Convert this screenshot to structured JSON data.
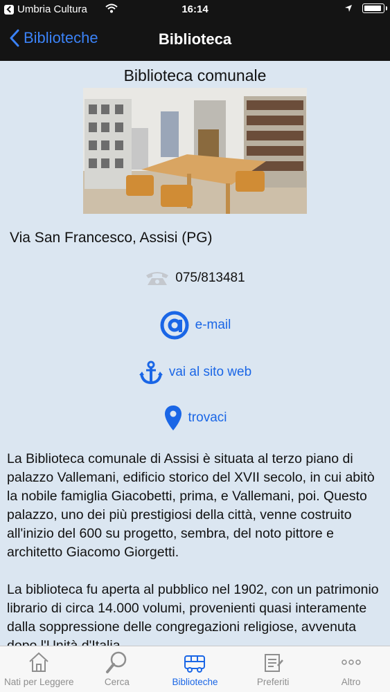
{
  "status_bar": {
    "back_app": "Umbria Cultura",
    "time": "16:14"
  },
  "nav": {
    "back_label": "Biblioteche",
    "title": "Biblioteca"
  },
  "library": {
    "name": "Biblioteca comunale",
    "address": "Via San Francesco, Assisi (PG)",
    "phone": "075/813481",
    "email_label": "e-mail",
    "website_label": "vai al sito web",
    "map_label": "trovaci",
    "description": [
      "La Biblioteca comunale di Assisi è situata al terzo piano di palazzo Vallemani, edificio storico del XVII secolo, in cui abitò la nobile famiglia Giacobetti, prima, e Vallemani, poi. Questo palazzo, uno dei più prestigiosi della città, venne costruito all'inizio del 600 su progetto, sembra, del noto pittore e architetto Giacomo Giorgetti.",
      "La biblioteca fu aperta al pubblico nel 1902, con un patrimonio librario di circa 14.000 volumi, provenienti quasi interamente dalla soppressione delle congregazioni religiose, avvenuta dopo l'Unità d'Italia."
    ]
  },
  "tabs": [
    {
      "label": "Nati per Leggere",
      "icon": "house-icon"
    },
    {
      "label": "Cerca",
      "icon": "search-icon"
    },
    {
      "label": "Biblioteche",
      "icon": "bus-icon",
      "active": true
    },
    {
      "label": "Preferiti",
      "icon": "notepad-icon"
    },
    {
      "label": "Altro",
      "icon": "more-icon"
    }
  ],
  "colors": {
    "accent": "#1a66e6",
    "background": "#dbe6f1",
    "navbar": "#141414"
  }
}
